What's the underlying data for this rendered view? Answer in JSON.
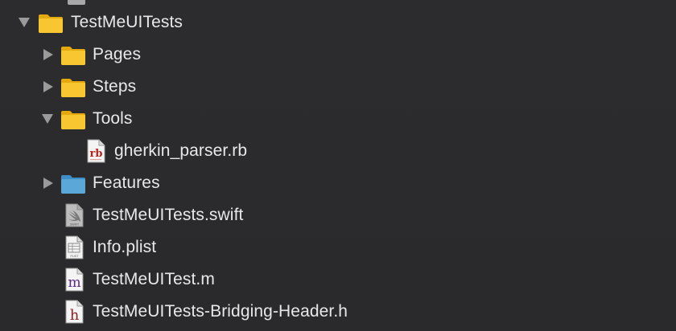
{
  "navigator": {
    "items": [
      {
        "label": "TestMeUITests",
        "kind": "folder",
        "expanded": true,
        "icon": "folder-icon"
      },
      {
        "label": "Pages",
        "kind": "folder",
        "expanded": false,
        "icon": "folder-icon"
      },
      {
        "label": "Steps",
        "kind": "folder",
        "expanded": false,
        "icon": "folder-icon"
      },
      {
        "label": "Tools",
        "kind": "folder",
        "expanded": true,
        "icon": "folder-icon"
      },
      {
        "label": "gherkin_parser.rb",
        "kind": "file",
        "icon": "ruby-file-icon",
        "badge": "rb"
      },
      {
        "label": "Features",
        "kind": "folder-reference",
        "expanded": false,
        "icon": "blue-folder-icon"
      },
      {
        "label": "TestMeUITests.swift",
        "kind": "file",
        "icon": "swift-file-icon",
        "badge": "SWIFT"
      },
      {
        "label": "Info.plist",
        "kind": "file",
        "icon": "plist-file-icon",
        "badge": "PLIST"
      },
      {
        "label": "TestMeUITest.m",
        "kind": "file",
        "icon": "objc-m-file-icon",
        "badge": "m"
      },
      {
        "label": "TestMeUITests-Bridging-Header.h",
        "kind": "file",
        "icon": "header-file-icon",
        "badge": "h"
      }
    ]
  },
  "colors": {
    "background": "#2b2b2d",
    "text": "#e8e8e8",
    "disclosure": "#9a9a9a",
    "folder_yellow": "#f7c631",
    "folder_blue": "#5aa7d8",
    "ruby_red": "#b9231c",
    "objc_purple": "#5b2a86",
    "header_red": "#8e1f1f"
  }
}
